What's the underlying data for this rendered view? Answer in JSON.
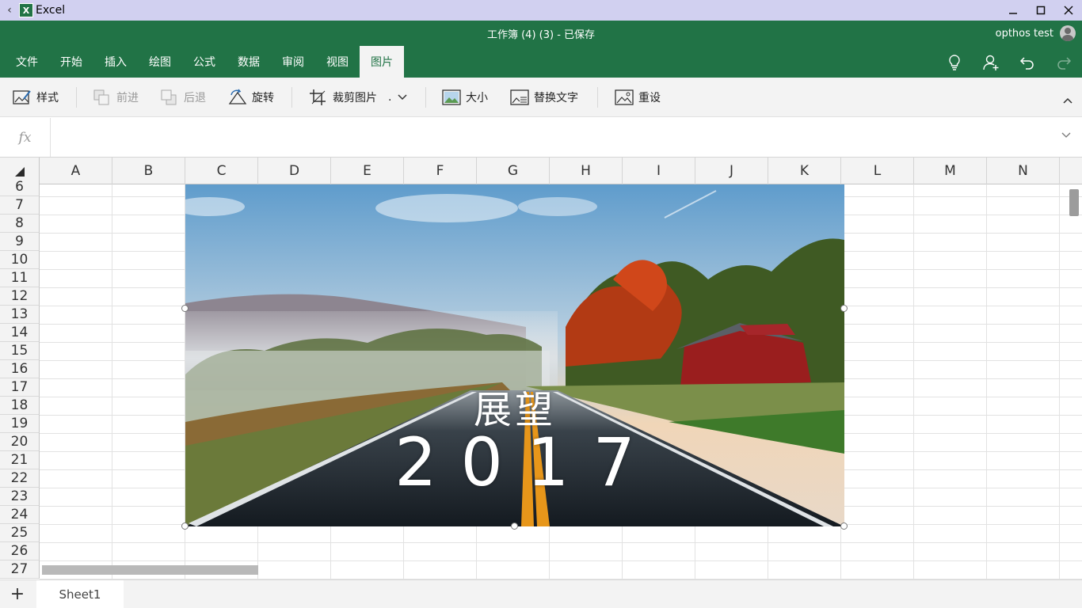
{
  "titlebar": {
    "app_name": "Excel",
    "logo_letter": "X"
  },
  "header": {
    "doc_title": "工作簿 (4) (3) - 已保存",
    "user_name": "opthos test",
    "tabs": [
      {
        "label": "文件"
      },
      {
        "label": "开始"
      },
      {
        "label": "插入"
      },
      {
        "label": "绘图"
      },
      {
        "label": "公式"
      },
      {
        "label": "数据"
      },
      {
        "label": "审阅"
      },
      {
        "label": "视图"
      },
      {
        "label": "图片",
        "active": true
      }
    ]
  },
  "ribbon": {
    "styles": "样式",
    "bring_forward": "前进",
    "send_backward": "后退",
    "rotate": "旋转",
    "crop": "裁剪图片",
    "crop_more": ".",
    "size": "大小",
    "alt_text": "替换文字",
    "reset": "重设"
  },
  "formula_bar": {
    "fx_label": "fx",
    "value": ""
  },
  "grid": {
    "columns": [
      "A",
      "B",
      "C",
      "D",
      "E",
      "F",
      "G",
      "H",
      "I",
      "J",
      "K",
      "L",
      "M",
      "N"
    ],
    "rows": [
      "6",
      "7",
      "8",
      "9",
      "10",
      "11",
      "12",
      "13",
      "14",
      "15",
      "16",
      "17",
      "18",
      "19",
      "20",
      "21",
      "22",
      "23",
      "24",
      "25",
      "26",
      "27"
    ]
  },
  "picture": {
    "line1": "展望",
    "line2": "2017"
  },
  "sheets": {
    "add_label": "+",
    "tabs": [
      {
        "label": "Sheet1"
      }
    ]
  },
  "colors": {
    "excel_green": "#217346",
    "titlebar": "#d1d0f0",
    "ribbon": "#f3f3f3"
  }
}
